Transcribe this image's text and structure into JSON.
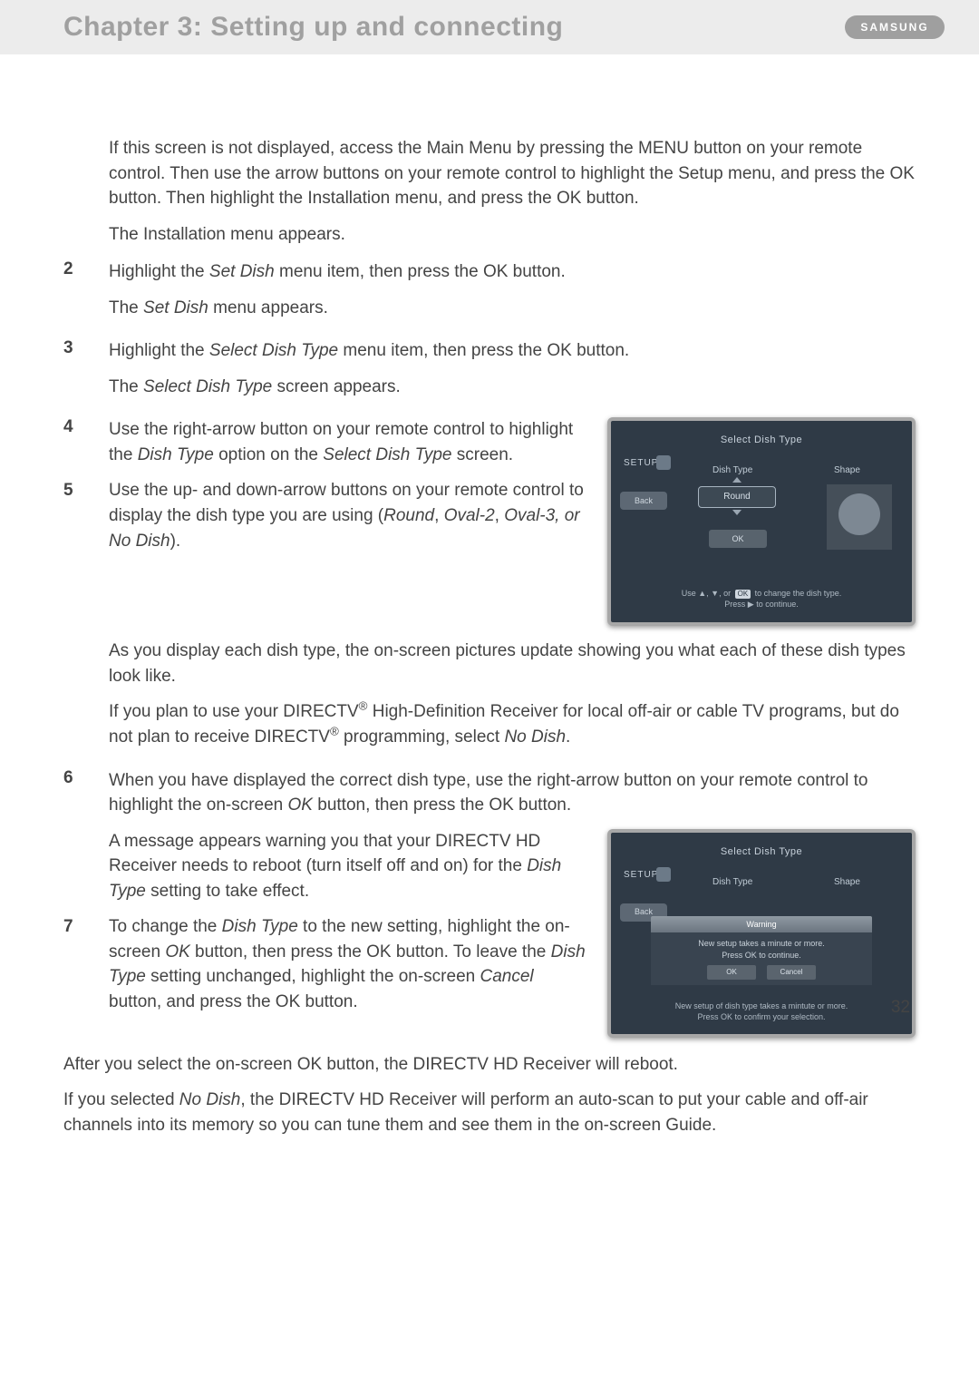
{
  "header": {
    "chapter_title": "Chapter 3: Setting up and connecting",
    "brand": "SAMSUNG"
  },
  "intro": {
    "p1": "If this screen is not displayed, access the Main Menu by pressing the MENU button on your remote control.  Then use the arrow buttons on your remote control to highlight the Setup menu, and press the OK button. Then highlight the Installation menu, and press the OK button.",
    "p2": "The Installation menu appears."
  },
  "steps": {
    "s2": {
      "num": "2",
      "line_pre": "Highlight the ",
      "line_em": "Set Dish",
      "line_post": " menu item, then press the OK button.",
      "result_pre": "The ",
      "result_em": "Set Dish",
      "result_post": " menu appears."
    },
    "s3": {
      "num": "3",
      "line_pre": "Highlight the ",
      "line_em": "Select Dish Type",
      "line_post": " menu item, then press the OK button.",
      "result_pre": "The ",
      "result_em": "Select Dish Type",
      "result_post": " screen appears."
    },
    "s4": {
      "num": "4",
      "line_pre": "Use the right-arrow button on your remote control to highlight the ",
      "line_em": "Dish Type",
      "line_mid": " option on the ",
      "line_em2": "Select Dish Type",
      "line_post": " screen."
    },
    "s5": {
      "num": "5",
      "line": "Use the up- and down-arrow buttons on your remote control to display the dish type you are using (",
      "em1": "Round",
      "comma1": ", ",
      "em2": "Oval-2",
      "comma2": ", ",
      "em3": "Oval-3, or No Dish",
      "close": ").",
      "after1": "As you display each dish type, the on-screen pictures update showing you what each of these dish types look like.",
      "after2_pre": "If you plan to use your DIRECTV",
      "after2_sup": "®",
      "after2_mid": " High-Definition Receiver for local off-air or cable TV programs, but do not plan to receive DIRECTV",
      "after2_sup2": "®",
      "after2_post": " programming, select ",
      "after2_em": "No Dish",
      "after2_end": "."
    },
    "s6": {
      "num": "6",
      "line_pre": "When you have displayed the correct dish type, use the right-arrow button on your remote control to highlight the on-screen ",
      "line_em": "OK",
      "line_post": " button, then press the OK button.",
      "result_pre": "A message appears warning you that your DIRECTV HD Receiver needs to reboot (turn itself off and on) for the ",
      "result_em": "Dish Type",
      "result_post": " setting to take effect."
    },
    "s7": {
      "num": "7",
      "line_pre": "To change the ",
      "line_em": "Dish Type",
      "line_mid": " to the new setting, highlight the on-screen ",
      "line_em2": "OK",
      "line_mid2": " button, then press the OK button. To leave the ",
      "line_em3": "Dish Type",
      "line_mid3": " setting unchanged, highlight the on-screen ",
      "line_em4": "Cancel",
      "line_post": " button, and press the OK button."
    }
  },
  "screenshot1": {
    "title": "Select Dish Type",
    "setup": "SETUP",
    "col_left": "Dish Type",
    "col_right": "Shape",
    "back": "Back",
    "value": "Round",
    "ok": "OK",
    "hint_pre": "Use ▲, ▼, or ",
    "hint_ok": "OK",
    "hint_post": " to change the dish type.",
    "hint_line2": "Press ▶ to continue."
  },
  "screenshot2": {
    "title": "Select Dish Type",
    "setup": "SETUP",
    "col_left": "Dish Type",
    "col_right": "Shape",
    "back": "Back",
    "warning_title": "Warning",
    "warning_line1": "New setup takes a minute or more.",
    "warning_line2": "Press OK to continue.",
    "btn_ok": "OK",
    "btn_cancel": "Cancel",
    "hint_line1": "New setup of dish type takes a mintute or more.",
    "hint_pre": "Press ",
    "hint_ok": "OK",
    "hint_post": " to confirm your selection."
  },
  "after": {
    "p1": "After you select the on-screen OK button, the DIRECTV HD Receiver will reboot.",
    "p2_pre": "If you selected ",
    "p2_em": "No Dish",
    "p2_post": ", the DIRECTV HD Receiver will perform an auto-scan to put your cable and off-air channels into its memory so you can tune them and see them in the on-screen Guide."
  },
  "page_number": "32"
}
